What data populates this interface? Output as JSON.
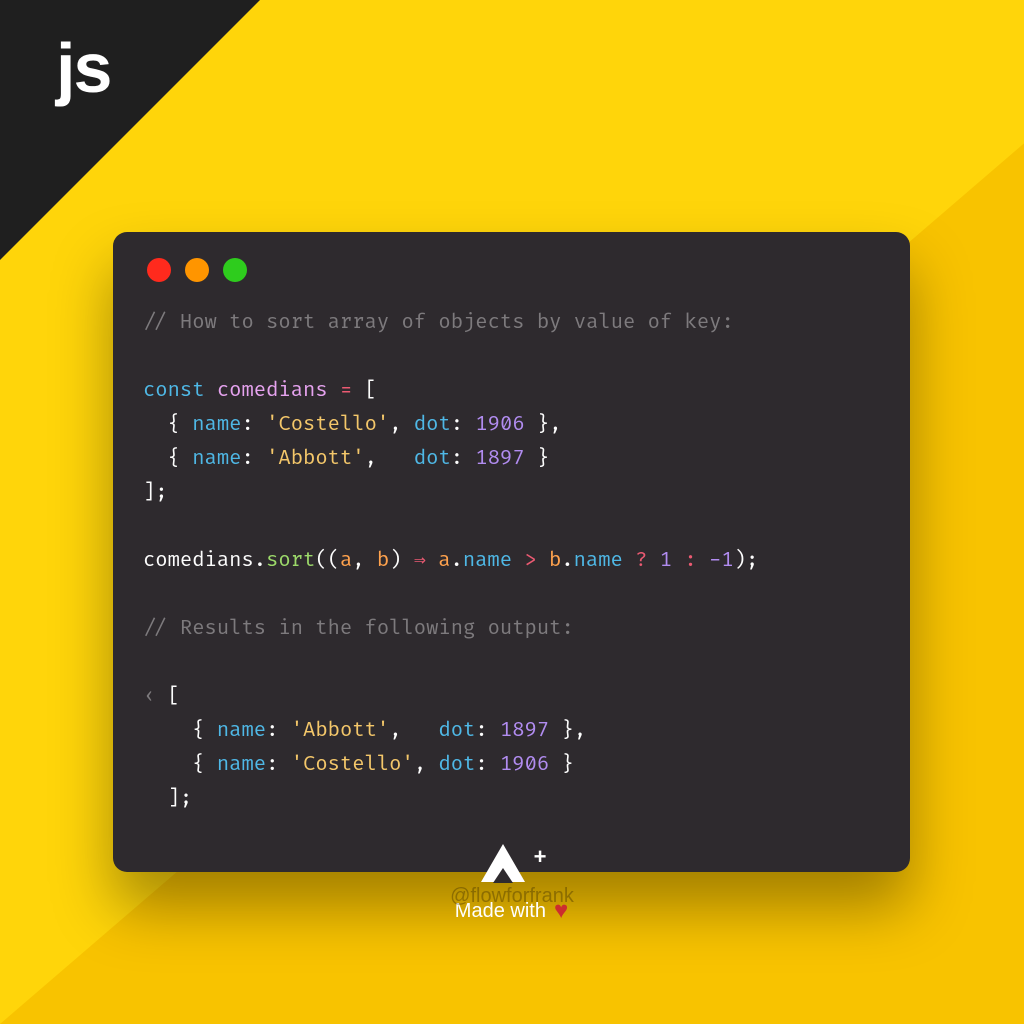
{
  "corner_label": "js",
  "code": {
    "comment1": "// How to sort array of objects by value of key:",
    "const": "const",
    "varname": "comedians",
    "eq": "=",
    "open": "[",
    "row1_name_k": "name",
    "row1_name_v": "'Costello'",
    "row1_dot_k": "dot",
    "row1_dot_v": "1906",
    "row2_name_k": "name",
    "row2_name_v": "'Abbott'",
    "row2_dot_k": "dot",
    "row2_dot_v": "1897",
    "close": "];",
    "sort_obj": "comedians",
    "sort_method": "sort",
    "sort_a": "a",
    "sort_b": "b",
    "sort_arrow": "⇒",
    "sort_a2": "a",
    "sort_name1": "name",
    "sort_gt": ">",
    "sort_b2": "b",
    "sort_name2": "name",
    "sort_q": "?",
    "sort_1": "1",
    "sort_c": ":",
    "sort_n1": "-1",
    "comment2": "// Results in the following output:",
    "outmark": "‹",
    "out_open": "[",
    "out1_name_k": "name",
    "out1_name_v": "'Abbott'",
    "out1_dot_k": "dot",
    "out1_dot_v": "1897",
    "out2_name_k": "name",
    "out2_name_v": "'Costello'",
    "out2_dot_k": "dot",
    "out2_dot_v": "1906",
    "out_close": "];"
  },
  "footer": {
    "plus": "+",
    "made": "Made with"
  },
  "handle": "@flowforfrank"
}
